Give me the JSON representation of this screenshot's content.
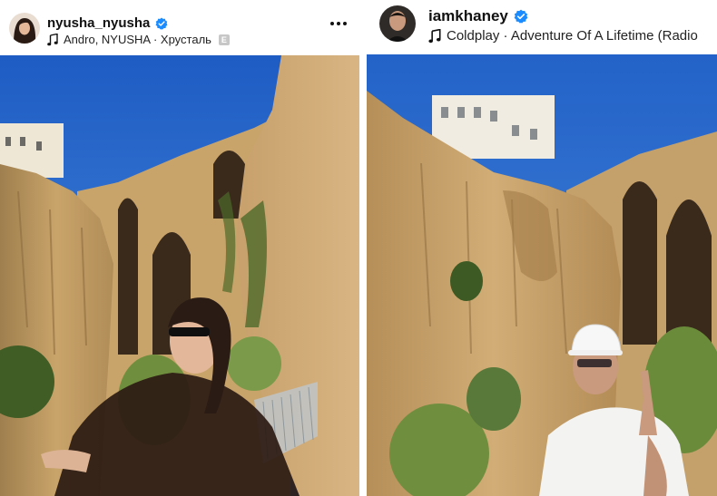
{
  "posts": [
    {
      "username": "nyusha_nyusha",
      "verified": true,
      "music": "Andro, NYUSHA · Хрусталь",
      "explicit_badge": "E",
      "icons": {
        "verified": "verified-badge-icon",
        "music": "music-note-icon",
        "more": "more-options-icon"
      }
    },
    {
      "username": "iamkhaney",
      "verified": true,
      "music": "Coldplay · Adventure Of A Lifetime (Radio",
      "icons": {
        "verified": "verified-badge-icon",
        "music": "music-note-icon"
      }
    }
  ],
  "colors": {
    "verified": "#1a8cff",
    "sky": "#2f6fcf",
    "rock": "#c9a46a"
  }
}
